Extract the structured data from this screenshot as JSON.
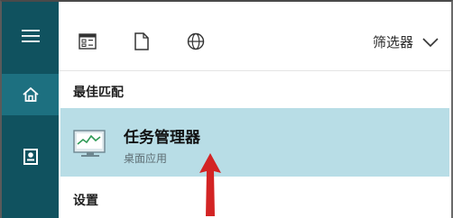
{
  "rail": {
    "items": [
      {
        "icon": "hamburger-menu-icon"
      },
      {
        "icon": "home-icon",
        "selected": true
      },
      {
        "icon": "documents-icon"
      }
    ]
  },
  "toolbar": {
    "icons": [
      "apps-icon",
      "document-icon",
      "web-globe-icon"
    ],
    "filter_label": "筛选器",
    "filter_icon": "chevron-down-icon"
  },
  "results": {
    "best_match_title": "最佳匹配",
    "top_result": {
      "name": "任务管理器",
      "type": "桌面应用",
      "icon": "task-manager-icon"
    },
    "settings_title": "设置"
  },
  "colors": {
    "rail_bg": "#10525f",
    "rail_selected": "#1d7080",
    "result_highlight": "#b8dde6",
    "annotation_arrow": "#d32424"
  }
}
